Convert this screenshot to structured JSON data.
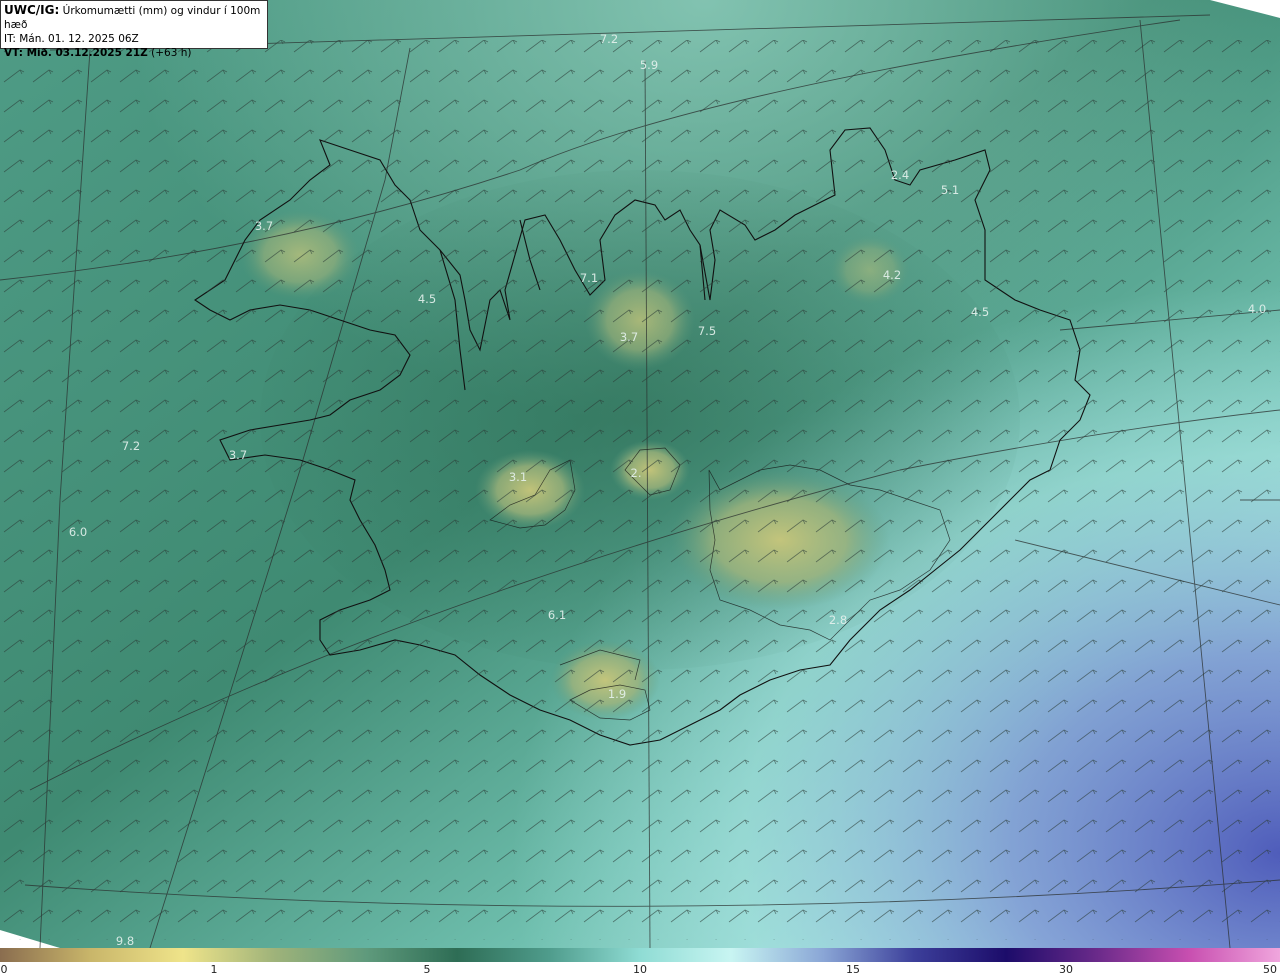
{
  "header": {
    "code": "UWC/IG:",
    "title": "Úrkomumætti (mm) og vindur í 100m hæð",
    "it_line": "IT: Mán. 01. 12. 2025 06Z",
    "vt_label": "VT: Mið. 03.12.2025 21Z",
    "vt_offset": "(+63 h)"
  },
  "map_labels": [
    {
      "id": "a",
      "text": "7.2"
    },
    {
      "id": "b",
      "text": "5.9"
    },
    {
      "id": "c",
      "text": "3.7"
    },
    {
      "id": "d",
      "text": "2.4"
    },
    {
      "id": "e",
      "text": "5.1"
    },
    {
      "id": "f",
      "text": "4.2"
    },
    {
      "id": "g",
      "text": "7.1"
    },
    {
      "id": "h",
      "text": "7.5"
    },
    {
      "id": "i",
      "text": "3.7"
    },
    {
      "id": "j",
      "text": "4.5"
    },
    {
      "id": "k",
      "text": "4.5"
    },
    {
      "id": "l",
      "text": "7.2"
    },
    {
      "id": "m",
      "text": "3.7"
    },
    {
      "id": "n",
      "text": "3.1"
    },
    {
      "id": "o",
      "text": "2."
    },
    {
      "id": "p",
      "text": "6.0"
    },
    {
      "id": "q",
      "text": "6.1"
    },
    {
      "id": "r",
      "text": "2.8"
    },
    {
      "id": "s",
      "text": "1.9"
    },
    {
      "id": "t",
      "text": "9.8"
    },
    {
      "id": "u",
      "text": "4.0"
    }
  ],
  "colorbar": {
    "ticks": [
      "0",
      "1",
      "5",
      "10",
      "15",
      "30",
      "50"
    ],
    "colors": [
      "#8a6d4f",
      "#c9b66a",
      "#efe48a",
      "#9fb37a",
      "#5f9a7c",
      "#2e6d55",
      "#4f9c8c",
      "#8fdcd4",
      "#c8f5f2",
      "#8aa6d6",
      "#3c3f9a",
      "#1c0c6a",
      "#6a2a8a",
      "#c84fb0",
      "#f0a6dd"
    ]
  }
}
